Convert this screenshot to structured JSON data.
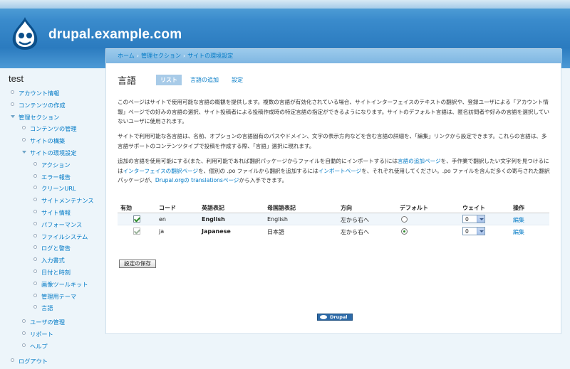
{
  "site": {
    "name": "drupal.example.com"
  },
  "sidebar": {
    "title": "test",
    "items": [
      {
        "label": "アカウント情報",
        "level": 0,
        "open": false
      },
      {
        "label": "コンテンツの作成",
        "level": 0,
        "open": false
      },
      {
        "label": "管理セクション",
        "level": 0,
        "open": true
      },
      {
        "label": "コンテンツの管理",
        "level": 1,
        "open": false
      },
      {
        "label": "サイトの構築",
        "level": 1,
        "open": false
      },
      {
        "label": "サイトの環境設定",
        "level": 1,
        "open": true
      },
      {
        "label": "アクション",
        "level": 2,
        "open": false
      },
      {
        "label": "エラー報告",
        "level": 2,
        "open": false
      },
      {
        "label": "クリーンURL",
        "level": 2,
        "open": false
      },
      {
        "label": "サイトメンテナンス",
        "level": 2,
        "open": false
      },
      {
        "label": "サイト情報",
        "level": 2,
        "open": false
      },
      {
        "label": "パフォーマンス",
        "level": 2,
        "open": false
      },
      {
        "label": "ファイルシステム",
        "level": 2,
        "open": false
      },
      {
        "label": "ログと警告",
        "level": 2,
        "open": false
      },
      {
        "label": "入力書式",
        "level": 2,
        "open": false
      },
      {
        "label": "日付と時刻",
        "level": 2,
        "open": false
      },
      {
        "label": "画像ツールキット",
        "level": 2,
        "open": false
      },
      {
        "label": "管理用テーマ",
        "level": 2,
        "open": false
      },
      {
        "label": "言語",
        "level": 2,
        "open": false
      },
      {
        "label": "ユーザの管理",
        "level": 1,
        "open": false
      },
      {
        "label": "リポート",
        "level": 1,
        "open": false
      },
      {
        "label": "ヘルプ",
        "level": 1,
        "open": false
      },
      {
        "label": "ログアウト",
        "level": 0,
        "open": false
      }
    ]
  },
  "breadcrumb": [
    "ホーム",
    "管理セクション",
    "サイトの環境設定"
  ],
  "page": {
    "title": "言語",
    "tabs": [
      {
        "label": "リスト",
        "active": true
      },
      {
        "label": "言語の追加",
        "active": false
      },
      {
        "label": "設定",
        "active": false
      }
    ]
  },
  "help": {
    "p1": "このページはサイトで使用可能な言語の概観を提供します。複数の言語が有効化されている場合、サイトインターフェイスのテキストの翻訳や、登録ユーザによる「アカウント情報」ページでの好みの言語の選択、サイト投稿者による投稿作成時の特定言語の指定ができるようになります。サイトのデフォルト言語は、匿名訪問者や好みの言語を選択していないユーザに使用されます。",
    "p2": "サイトで利用可能な各言語は、名前、オプションの言語固有のパスやドメイン、文字の表示方向などを含む言語の詳細を、「編集」リンクから設定できます。これらの言語は、多言語サポートのコンテンツタイプで投稿を作成する際、「言語」選択に現れます。",
    "p3_a": "追加の言語を使用可能にする(また、利用可能であれば翻訳パッケージからファイルを自動的にインポートする)には",
    "p3_link1": "言語の追加ページ",
    "p3_b": "を、手作業で翻訳したい文字列を見つけるには",
    "p3_link2": "インターフェイスの翻訳ページ",
    "p3_c": "を、個別の .po ファイルから翻訳を追加するには",
    "p3_link3": "インポートページ",
    "p3_d": "を、それぞれ使用してください。.po ファイルを含んだ多くの寄与された翻訳パッケージが、",
    "p3_link4": "Drupal.orgの translationsページ",
    "p3_e": "から入手できます。"
  },
  "table": {
    "headers": [
      "有効",
      "コード",
      "英語表記",
      "母国語表記",
      "方向",
      "デフォルト",
      "ウェイト",
      "操作"
    ],
    "rows": [
      {
        "enabled": true,
        "locked": false,
        "code": "en",
        "english": "English",
        "native": "English",
        "direction": "左から右へ",
        "default": false,
        "weight": "0",
        "op": "編集"
      },
      {
        "enabled": true,
        "locked": true,
        "code": "ja",
        "english": "Japanese",
        "native": "日本語",
        "direction": "左から右へ",
        "default": true,
        "weight": "0",
        "op": "編集"
      }
    ]
  },
  "save_label": "設定の保存",
  "footer": {
    "badge": "Drupal"
  },
  "colors": {
    "link": "#027ac6",
    "header": "#2b7bbf",
    "tab_active": "#a8cbe8"
  }
}
